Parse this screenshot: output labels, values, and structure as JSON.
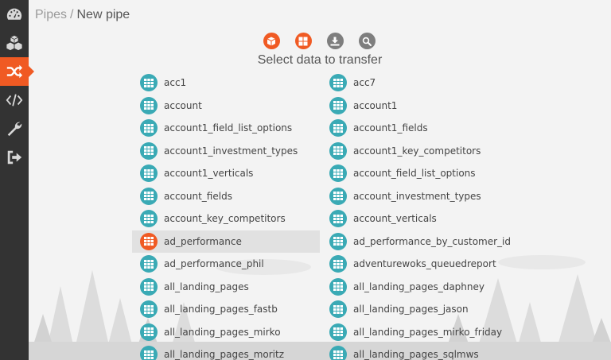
{
  "sidebar": {
    "items": [
      {
        "name": "dashboard",
        "icon": "speedometer-icon",
        "active": false
      },
      {
        "name": "boxes",
        "icon": "cubes-icon",
        "active": false
      },
      {
        "name": "pipes",
        "icon": "shuffle-icon",
        "active": true
      },
      {
        "name": "code",
        "icon": "code-icon",
        "active": false
      },
      {
        "name": "settings",
        "icon": "wrench-icon",
        "active": false
      },
      {
        "name": "logout",
        "icon": "sign-out-icon",
        "active": false
      }
    ]
  },
  "breadcrumb": {
    "parent": "Pipes",
    "separator": "/",
    "current": "New pipe"
  },
  "steps": [
    {
      "icon": "cube-icon",
      "state": "done"
    },
    {
      "icon": "grid-icon",
      "state": "done"
    },
    {
      "icon": "download-icon",
      "state": "pending"
    },
    {
      "icon": "search-icon",
      "state": "pending"
    }
  ],
  "heading": "Select data to transfer",
  "tables": [
    "acc1",
    "acc7",
    "account",
    "account1",
    "account1_field_list_options",
    "account1_fields",
    "account1_investment_types",
    "account1_key_competitors",
    "account1_verticals",
    "account_field_list_options",
    "account_fields",
    "account_investment_types",
    "account_key_competitors",
    "account_verticals",
    "ad_performance",
    "ad_performance_by_customer_id",
    "ad_performance_phil",
    "adventurewoks_queuedreport",
    "all_landing_pages",
    "all_landing_pages_daphney",
    "all_landing_pages_fastb",
    "all_landing_pages_jason",
    "all_landing_pages_mirko",
    "all_landing_pages_mirko_friday",
    "all_landing_pages_moritz",
    "all_landing_pages_sqlmws"
  ],
  "selected_table": "ad_performance",
  "colors": {
    "accent": "#f05a23",
    "table_icon": "#3aaab5",
    "sidebar": "#333333",
    "pending_step": "#7e7e7e"
  }
}
